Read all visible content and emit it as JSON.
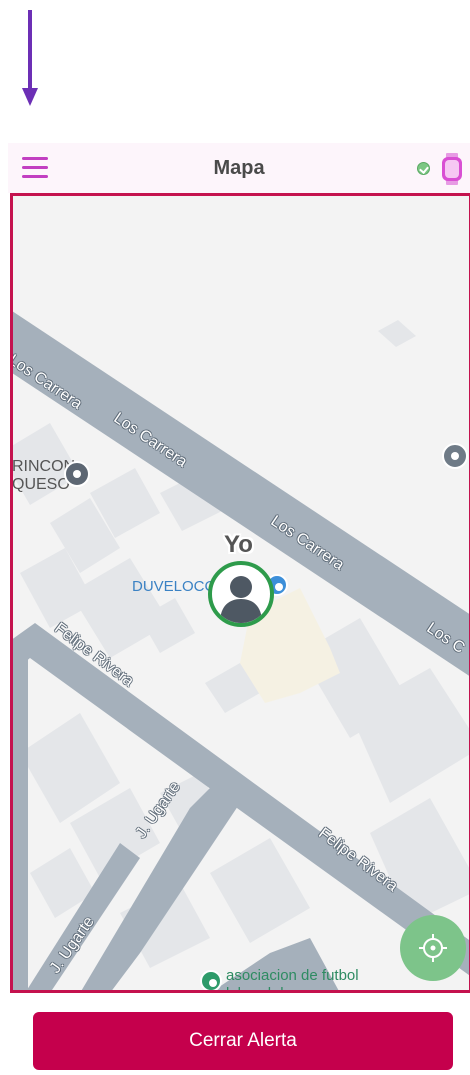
{
  "header": {
    "title": "Mapa",
    "menu_icon": "hamburger-menu-icon",
    "status_icon": "check-circle-icon",
    "device_icon": "smartwatch-icon"
  },
  "map": {
    "streets": [
      "Los Carrera",
      "Los Carrera",
      "Los Carrera",
      "Los C",
      "Felipe Rivera",
      "Felipe Rivera",
      "J. Ugarte",
      "J. Ugarte"
    ],
    "pois": {
      "rincon_line1": "RINCON",
      "rincon_line2": "QUESO",
      "duveloc": "DUVELOCC",
      "asociacion_line1": "asociacion de futbol",
      "asociacion_line2": "laboral de comunas"
    },
    "user_label": "Yo"
  },
  "footer": {
    "close_alert_label": "Cerrar Alerta"
  },
  "colors": {
    "accent": "#c5004c",
    "menu": "#c23fc1",
    "map_frame": "#c4124e",
    "user_ring": "#2e9b4b",
    "locate_button": "#7dc48a"
  }
}
